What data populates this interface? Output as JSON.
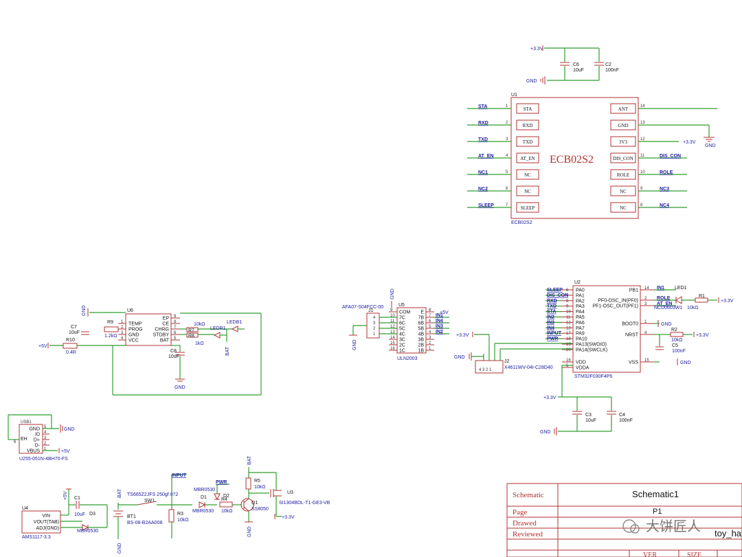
{
  "main_mcu": {
    "ref": "U1",
    "name": "ECB02S2",
    "footer": "ECB02S2",
    "left_pins": [
      {
        "num": "1",
        "label": "STA",
        "net": "STA"
      },
      {
        "num": "2",
        "label": "RXD",
        "net": "RXD"
      },
      {
        "num": "3",
        "label": "TXD",
        "net": "TXD"
      },
      {
        "num": "4",
        "label": "AT_EN",
        "net": "AT_EN"
      },
      {
        "num": "5",
        "label": "NC",
        "net": "NC1"
      },
      {
        "num": "6",
        "label": "NC",
        "net": "NC2"
      },
      {
        "num": "7",
        "label": "SLEEP",
        "net": "SLEEP"
      }
    ],
    "right_pins": [
      {
        "num": "14",
        "label": "ANT",
        "net": ""
      },
      {
        "num": "13",
        "label": "GND",
        "net": ""
      },
      {
        "num": "12",
        "label": "3V3",
        "net": ""
      },
      {
        "num": "11",
        "label": "DIS_CON",
        "net": "DIS_CON"
      },
      {
        "num": "10",
        "label": "ROLE",
        "net": "ROLE"
      },
      {
        "num": "9",
        "label": "NC",
        "net": "NC3"
      },
      {
        "num": "8",
        "label": "NC",
        "net": "NC4"
      }
    ],
    "pwr_3v3": "+3.3V",
    "gnd": "GND"
  },
  "decoupling_top": {
    "rail": "+3.3V",
    "gnd": "GND",
    "c6": {
      "ref": "C6",
      "value": "10uF"
    },
    "c2": {
      "ref": "C2",
      "value": "100nF"
    }
  },
  "stm32": {
    "ref": "U2",
    "part": "STM32F030F4P6",
    "left_pins": [
      {
        "num": "6",
        "label": "PA0",
        "net": "SLEEP"
      },
      {
        "num": "7",
        "label": "PA1",
        "net": "DIS_CON"
      },
      {
        "num": "8",
        "label": "PA2",
        "net": "RXD"
      },
      {
        "num": "9",
        "label": "PA3",
        "net": "TXD"
      },
      {
        "num": "10",
        "label": "PA4",
        "net": "STA"
      },
      {
        "num": "11",
        "label": "PA5",
        "net": "IN2"
      },
      {
        "num": "12",
        "label": "PA6",
        "net": "IN3"
      },
      {
        "num": "13",
        "label": "PA7",
        "net": "IN4"
      },
      {
        "num": "17",
        "label": "PA9",
        "net": "INPUT"
      },
      {
        "num": "18",
        "label": "PA10",
        "net": "PWR"
      },
      {
        "num": "19",
        "label": "PA13(SWDIO)",
        "net": ""
      },
      {
        "num": "20",
        "label": "PA14(SWCLK)",
        "net": ""
      }
    ],
    "left_pins_low": [
      {
        "num": "16",
        "label": "VDD"
      },
      {
        "num": "5",
        "label": "VDDA"
      }
    ],
    "right_pins": [
      {
        "num": "14",
        "label": "PB1",
        "net": "IN1"
      },
      {
        "num": "2",
        "label": "PF0-OSC_IN(PF0)",
        "net": "ROLE"
      },
      {
        "num": "3",
        "label": "PF1-OSC_OUT(PF1)",
        "net": "AT_EN"
      },
      {
        "num": "1",
        "label": "BOOT0",
        "net": ""
      },
      {
        "num": "4",
        "label": "NRST",
        "net": ""
      },
      {
        "num": "15",
        "label": "VSS",
        "net": ""
      }
    ],
    "led1": {
      "ref": "LED1",
      "part": "NCD0603W1"
    },
    "r1": {
      "ref": "R1",
      "value": "10kΩ"
    },
    "r2": {
      "ref": "R2",
      "value": "10kΩ"
    },
    "c5": {
      "ref": "C5",
      "value": "100nF"
    },
    "gnd": "GND",
    "rail": "+3.3V"
  },
  "swd_header": {
    "ref": "J2",
    "part": "X4611WV-04I-C28D40",
    "pins": [
      "4",
      "3",
      "2",
      "1"
    ],
    "rail": "+3.3V",
    "gnd": "GND"
  },
  "vdd_decoupling": {
    "rail": "+3.3V",
    "gnd": "GND",
    "c3": {
      "ref": "C3",
      "value": "10uF"
    },
    "c4": {
      "ref": "C4",
      "value": "100nF"
    }
  },
  "uln": {
    "ref": "U5",
    "part": "ULN2003",
    "left_pins": [
      "COM",
      "7C",
      "6C",
      "5C",
      "4C",
      "3C",
      "2C",
      "1C"
    ],
    "left_nums": [
      "9",
      "10",
      "11",
      "12",
      "13",
      "14",
      "15",
      "16"
    ],
    "right_pins": [
      "E",
      "7B",
      "6B",
      "5B",
      "4B",
      "3B",
      "2B",
      "1B"
    ],
    "right_nums": [
      "8",
      "7",
      "6",
      "5",
      "4",
      "3",
      "2",
      "1"
    ],
    "nets_right": [
      "IN1",
      "IN4",
      "IN3",
      "IN2"
    ],
    "rail": "+5V",
    "gnd": "GND",
    "conn": {
      "ref": "J1",
      "part": "AFA07-S04FCC-00",
      "pins": [
        "4",
        "3",
        "2",
        "1"
      ]
    }
  },
  "charger": {
    "ref": "U6",
    "left_pins": [
      "TEMP",
      "PROG",
      "GND",
      "VCC"
    ],
    "right_pins": [
      "EP",
      "CE",
      "CHRG",
      "STDBY",
      "BAT"
    ],
    "right_nums": [
      "9",
      "8",
      "7",
      "6",
      "5"
    ],
    "left_nums": [
      "1",
      "2",
      "3",
      "4"
    ],
    "c7": {
      "ref": "C7",
      "value": "10uF"
    },
    "r9": {
      "ref": "R9",
      "value": "1.2kΩ"
    },
    "r10": {
      "ref": "R10",
      "value": "0.4R"
    },
    "c8": {
      "ref": "C8",
      "value": "10uF"
    },
    "r7": {
      "ref": "R7",
      "value": "10kΩ"
    },
    "r8": {
      "ref": "R8",
      "value": "1kΩ"
    },
    "ledr1": "LEDR1",
    "ledb1": "LEDB1",
    "bat": "BAT",
    "gnd": "GND",
    "rail": "+5V"
  },
  "usb": {
    "ref": "USB1",
    "part": "U255-051N-4BH70-FS",
    "pins": [
      "GND",
      "ID",
      "D+",
      "D-",
      "VBUS"
    ],
    "pin_nums": [
      "5",
      "4",
      "3",
      "2",
      "1"
    ],
    "eh": "EH",
    "eh_num": "6",
    "gnd": "GND",
    "rail": "+5V"
  },
  "power": {
    "ldo": {
      "ref": "U4",
      "part": "AMS1117-3.3",
      "pins": [
        "VIN",
        "VOUT(TAB)",
        "ADJ(GND)"
      ],
      "nums": [
        "3",
        "2",
        "1"
      ]
    },
    "c1": {
      "ref": "C1",
      "value": "10uF"
    },
    "d3": {
      "ref": "D3",
      "part": "MBR0530"
    },
    "d1": {
      "ref": "D1",
      "part": "MBR0530"
    },
    "d2": {
      "ref": "D2",
      "part": "MBR0530"
    },
    "sw1": {
      "ref": "SW1",
      "part": "TS665Z2JFS 250gf 072"
    },
    "bt1": {
      "ref": "BT1",
      "part": "BS-08-B2AA008"
    },
    "r3": {
      "ref": "R3",
      "value": "10kΩ"
    },
    "r4": {
      "ref": "R4",
      "value": "10kΩ"
    },
    "r5": {
      "ref": "R5",
      "value": "10kΩ"
    },
    "q1": {
      "ref": "Q1",
      "part": "SS8050"
    },
    "u3": {
      "ref": "U3",
      "part": "SI1304BDL-T1-GE3-VB"
    },
    "nets": {
      "input": "INPUT",
      "pwr": "PWR",
      "bat": "BAT",
      "p5v": "+5V",
      "p33": "+3.3V",
      "gnd": "GND"
    }
  },
  "title_block": {
    "schematic_label": "Schematic",
    "schematic_value": "Schematic1",
    "page_label": "Page",
    "page_value": "P1",
    "drawn_label": "Drawed",
    "reviewed_label": "Reviewed",
    "project_value": "toy_ha",
    "ver_label": "VER",
    "size_label": "SIZE",
    "watermark": "大饼匠人"
  }
}
